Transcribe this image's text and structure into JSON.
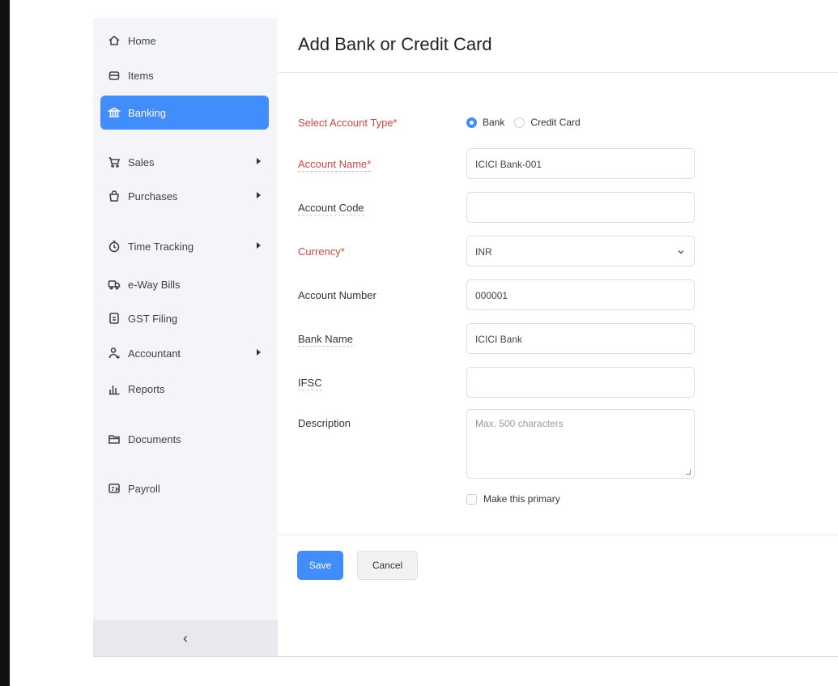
{
  "sidebar": {
    "items": [
      {
        "label": "Home",
        "icon": "home-icon",
        "has_arrow": false,
        "active": false
      },
      {
        "label": "Items",
        "icon": "box-icon",
        "has_arrow": false,
        "active": false
      },
      {
        "label": "Banking",
        "icon": "bank-icon",
        "has_arrow": false,
        "active": true
      },
      {
        "label": "Sales",
        "icon": "cart-icon",
        "has_arrow": true,
        "active": false
      },
      {
        "label": "Purchases",
        "icon": "bag-icon",
        "has_arrow": true,
        "active": false
      },
      {
        "label": "Time Tracking",
        "icon": "clock-icon",
        "has_arrow": true,
        "active": false
      },
      {
        "label": "e-Way Bills",
        "icon": "truck-icon",
        "has_arrow": false,
        "active": false
      },
      {
        "label": "GST Filing",
        "icon": "document-icon",
        "has_arrow": false,
        "active": false
      },
      {
        "label": "Accountant",
        "icon": "user-icon",
        "has_arrow": true,
        "active": false
      },
      {
        "label": "Reports",
        "icon": "bar-chart-icon",
        "has_arrow": false,
        "active": false
      },
      {
        "label": "Documents",
        "icon": "folder-icon",
        "has_arrow": false,
        "active": false
      },
      {
        "label": "Payroll",
        "icon": "payroll-icon",
        "has_arrow": false,
        "active": false
      }
    ],
    "collapse_glyph": "‹"
  },
  "form": {
    "title": "Add Bank or Credit Card",
    "account_type_label": "Select Account Type*",
    "account_type_options": [
      "Bank",
      "Credit Card"
    ],
    "account_type_selected": "Bank",
    "account_name_label": "Account Name*",
    "account_name_value": "ICICI Bank-001",
    "account_code_label": "Account Code",
    "account_code_value": "",
    "currency_label": "Currency*",
    "currency_value": "INR",
    "account_number_label": "Account Number",
    "account_number_value": "000001",
    "bank_name_label": "Bank Name",
    "bank_name_value": "ICICI Bank",
    "ifsc_label": "IFSC",
    "ifsc_value": "",
    "description_label": "Description",
    "description_placeholder": "Max. 500 characters",
    "primary_label": "Make this primary",
    "primary_checked": false,
    "save_label": "Save",
    "cancel_label": "Cancel"
  },
  "colors": {
    "accent": "#408dfb",
    "required_label": "#d6463f",
    "sidebar_bg": "#f4f5f8"
  }
}
